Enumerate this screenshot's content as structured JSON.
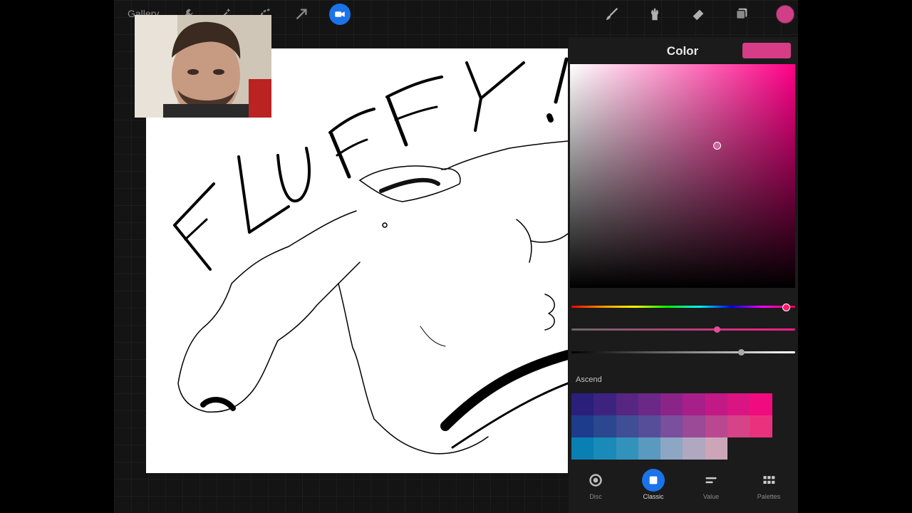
{
  "app": {
    "gallery_label": "Gallery",
    "toolbar_left_icons": [
      "wrench-icon",
      "magic-wand-icon",
      "selection-icon",
      "transform-arrow-icon"
    ],
    "record_button_icon": "video-camera-icon",
    "toolbar_right_icons": [
      "brush-icon",
      "smudge-icon",
      "eraser-icon",
      "layers-icon"
    ],
    "current_color": "#cf3f86"
  },
  "canvas": {
    "drawing_text": "FLUFFY!"
  },
  "color_panel": {
    "title": "Color",
    "current_swatch": "#d63d86",
    "hue_color": "#ff0087",
    "hue_level": 0.95,
    "saturation_level": 0.64,
    "brightness_level": 0.75,
    "palette_name": "Ascend",
    "palette_rows": [
      [
        "#2a1f7a",
        "#3d2380",
        "#562683",
        "#6c2886",
        "#8b2488",
        "#a71f88",
        "#c11a86",
        "#d91583",
        "#f00c7f"
      ],
      [
        "#1d3c8b",
        "#2b478f",
        "#3f4e95",
        "#574e99",
        "#7a4f9b",
        "#9a4a97",
        "#b94890",
        "#d54488",
        "#e9327e"
      ],
      [
        "#0a7fb4",
        "#1a8ab8",
        "#3392bc",
        "#5a9ac0",
        "#8da6c4",
        "#b0a8c0",
        "#cda5b8"
      ]
    ],
    "modes": [
      {
        "label": "Disc",
        "icon": "disc-icon"
      },
      {
        "label": "Classic",
        "icon": "classic-square-icon",
        "active": true
      },
      {
        "label": "Value",
        "icon": "value-sliders-icon"
      },
      {
        "label": "Palettes",
        "icon": "palettes-grid-icon"
      }
    ]
  },
  "webcam": {
    "description_icon": "webcam-video-feed"
  }
}
